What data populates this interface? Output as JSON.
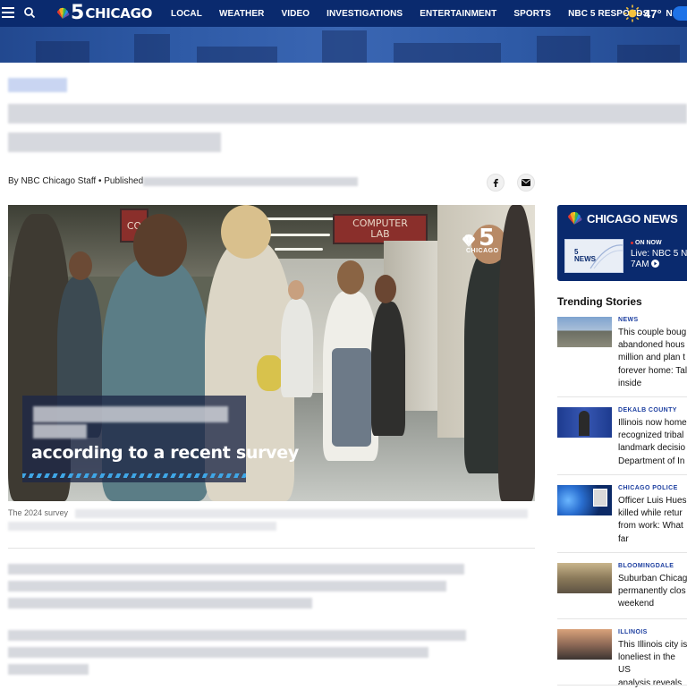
{
  "header": {
    "logo_number": "5",
    "logo_city": "CHICAGO",
    "nav_items": [
      "LOCAL",
      "WEATHER",
      "VIDEO",
      "INVESTIGATIONS",
      "ENTERTAINMENT",
      "SPORTS",
      "NBC 5 RESPONDS",
      "N..."
    ],
    "temperature": "47°",
    "weather_icon": "sun-icon"
  },
  "article": {
    "byline": "By NBC Chicago Staff • Published",
    "share_icons": [
      "facebook-icon",
      "email-icon"
    ]
  },
  "hero": {
    "caption_overlay": "according to a recent survey",
    "sign_left": "CO",
    "sign_center": "COMPUTER\nLAB",
    "watermark_number": "5",
    "watermark_city": "CHICAGO"
  },
  "photo_caption": "The 2024 survey",
  "sidebar": {
    "live_title": "CHICAGO NEWS",
    "on_now": "ON NOW",
    "live_text": "Live: NBC 5 N 7AM",
    "thumb_label": "5 NEWS",
    "trending_title": "Trending Stories",
    "stories": [
      {
        "category": "NEWS",
        "headline": "This couple boug\nabandoned hous\nmillion and plan t\nforever home: Tal\ninside"
      },
      {
        "category": "DEKALB COUNTY",
        "headline": "Illinois now home\nrecognized tribal\nlandmark decisio\nDepartment of In"
      },
      {
        "category": "CHICAGO POLICE",
        "headline": "Officer Luis Hues\nkilled while retur\nfrom work: What \nfar"
      },
      {
        "category": "BLOOMINGDALE",
        "headline": "Suburban Chicag\npermanently clos\nweekend"
      },
      {
        "category": "ILLINOIS",
        "headline": "This Illinois city is\nloneliest in the US\nanalysis reveals"
      }
    ]
  },
  "colors": {
    "header_bg": "#0a2a6e",
    "accent_blue": "#1e73e8",
    "category_blue": "#1d3fa0"
  }
}
